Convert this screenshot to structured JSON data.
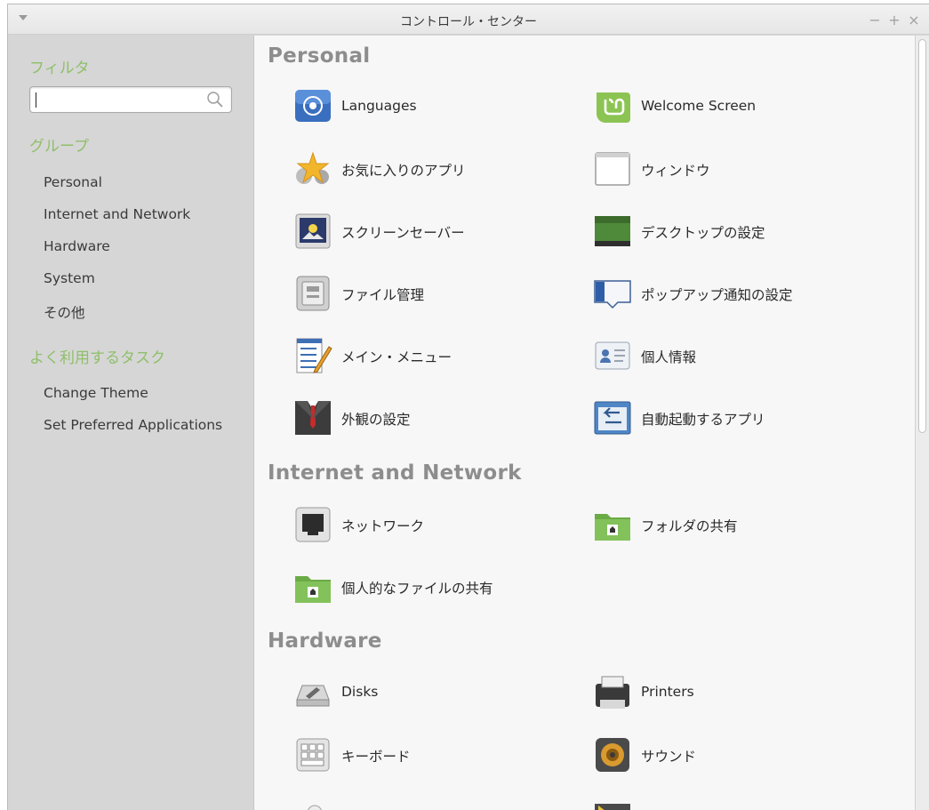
{
  "window": {
    "title": "コントロール・センター"
  },
  "wm": {
    "minimize": "−",
    "maximize": "+",
    "close": "×"
  },
  "sidebar": {
    "filter_heading": "フィルタ",
    "search_value": "",
    "group_heading": "グループ",
    "groups": [
      "Personal",
      "Internet and Network",
      "Hardware",
      "System",
      "その他"
    ],
    "tasks_heading": "よく利用するタスク",
    "tasks": [
      "Change Theme",
      "Set Preferred Applications"
    ]
  },
  "sections": [
    {
      "title": "Personal",
      "items": [
        {
          "label": "Languages",
          "icon": "un-flag-icon"
        },
        {
          "label": "Welcome Screen",
          "icon": "mint-logo-icon"
        },
        {
          "label": "お気に入りのアプリ",
          "icon": "star-gears-icon"
        },
        {
          "label": "ウィンドウ",
          "icon": "window-icon"
        },
        {
          "label": "スクリーンセーバー",
          "icon": "screensaver-icon"
        },
        {
          "label": "デスクトップの設定",
          "icon": "desktop-icon"
        },
        {
          "label": "ファイル管理",
          "icon": "file-manager-icon"
        },
        {
          "label": "ポップアップ通知の設定",
          "icon": "notification-icon"
        },
        {
          "label": "メイン・メニュー",
          "icon": "menu-editor-icon"
        },
        {
          "label": "個人情報",
          "icon": "personal-info-icon"
        },
        {
          "label": "外観の設定",
          "icon": "appearance-icon"
        },
        {
          "label": "自動起動するアプリ",
          "icon": "startup-apps-icon"
        }
      ]
    },
    {
      "title": "Internet and Network",
      "items": [
        {
          "label": "ネットワーク",
          "icon": "network-icon"
        },
        {
          "label": "フォルダの共有",
          "icon": "shared-folder-icon"
        },
        {
          "label": "個人的なファイルの共有",
          "icon": "personal-share-icon"
        }
      ]
    },
    {
      "title": "Hardware",
      "items": [
        {
          "label": "Disks",
          "icon": "disks-icon"
        },
        {
          "label": "Printers",
          "icon": "printer-icon"
        },
        {
          "label": "キーボード",
          "icon": "keyboard-icon"
        },
        {
          "label": "サウンド",
          "icon": "sound-icon"
        }
      ]
    }
  ],
  "colors": {
    "accent_green": "#8fbf6a",
    "section_gray": "#8d8d8d"
  }
}
